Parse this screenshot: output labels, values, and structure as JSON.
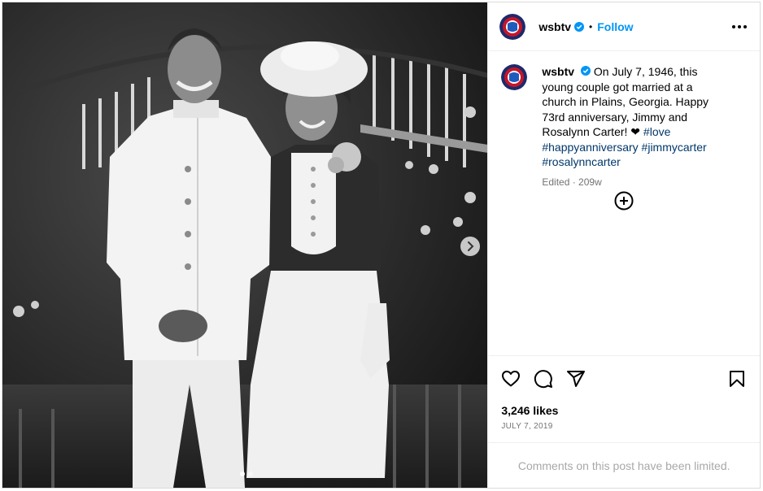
{
  "header": {
    "username": "wsbtv",
    "separator": "•",
    "follow_label": "Follow"
  },
  "caption": {
    "username": "wsbtv",
    "text": "On July 7, 1946, this young couple got married at a church in Plains, Georgia. Happy 73rd anniversary, Jimmy and Rosalynn Carter! ❤",
    "hashtags": [
      "#love",
      "#happyanniversary",
      "#jimmycarter",
      "#rosalynncarter"
    ],
    "meta": "Edited · 209w"
  },
  "engagement": {
    "likes": "3,246 likes",
    "date": "JULY 7, 2019"
  },
  "comments_notice": "Comments on this post have been limited.",
  "carousel": {
    "slide_count": 2,
    "active_slide": 1
  },
  "icons": [
    "verified-badge-icon",
    "more-options-icon",
    "add-comment-icon",
    "like-heart-icon",
    "comment-icon",
    "share-icon",
    "bookmark-icon",
    "carousel-next-icon"
  ],
  "colors": {
    "follow": "#0095f6",
    "hashtag": "#00376b",
    "muted": "#737373",
    "notice": "#a8a8a8",
    "verified": "#0095f6"
  }
}
